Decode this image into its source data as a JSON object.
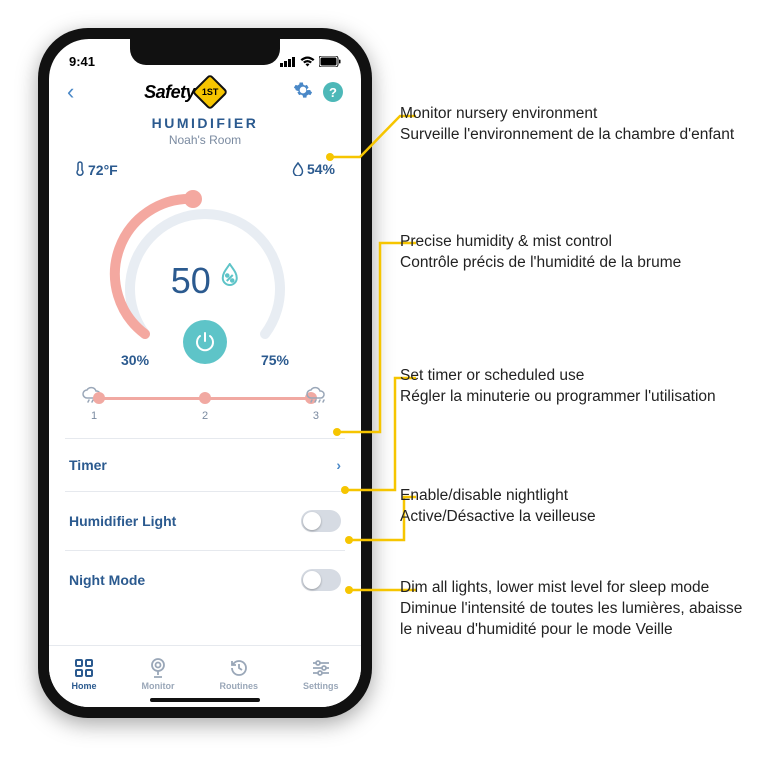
{
  "statusbar": {
    "time": "9:41"
  },
  "header": {
    "brand_text": "Safety",
    "brand_badge": "1ST"
  },
  "device": {
    "title": "HUMIDIFIER",
    "room": "Noah's Room"
  },
  "env": {
    "temp": "72°F",
    "humidity": "54%"
  },
  "dial": {
    "value": "50",
    "min": "30%",
    "max": "75%"
  },
  "mist": {
    "levels": [
      "1",
      "2",
      "3"
    ],
    "current": 2
  },
  "rows": {
    "timer": "Timer",
    "light": "Humidifier Light",
    "night": "Night Mode"
  },
  "tabs": {
    "home": "Home",
    "monitor": "Monitor",
    "routines": "Routines",
    "settings": "Settings"
  },
  "callouts": {
    "env_en": "Monitor nursery environment",
    "env_fr": "Surveille l'environnement de la chambre d'enfant",
    "dial_en": "Precise humidity & mist control",
    "dial_fr": "Contrôle précis de l'humidité de la brume",
    "timer_en": "Set timer or scheduled use",
    "timer_fr": "Régler la minuterie ou programmer l'utilisation",
    "light_en": "Enable/disable nightlight",
    "light_fr": "Active/Désactive la veilleuse",
    "night_en": "Dim all lights, lower mist level for sleep mode",
    "night_fr": "Diminue l'intensité de toutes les lumières, abaisse le niveau d'humidité pour le mode Veille"
  }
}
